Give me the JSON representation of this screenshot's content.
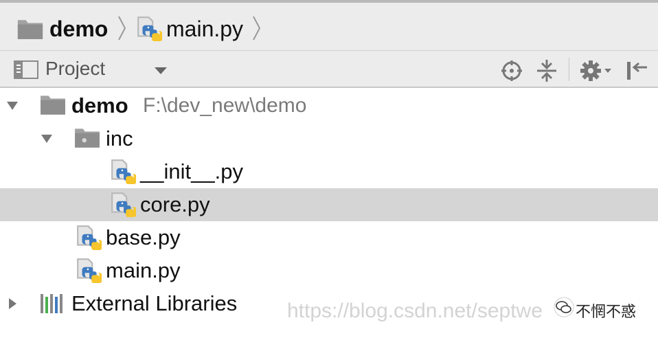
{
  "breadcrumb": {
    "project": "demo",
    "file": "main.py"
  },
  "tool_window": {
    "view_selector": "Project",
    "buttons": {
      "locate": "crosshair-icon",
      "collapse_all": "collapse-all-icon",
      "settings": "gear-icon",
      "hide": "hide-panel-icon"
    }
  },
  "tree": {
    "root": {
      "name": "demo",
      "path": "F:\\dev_new\\demo",
      "expanded": true
    },
    "inc": {
      "name": "inc",
      "expanded": true
    },
    "init_py": {
      "name": "__init__.py"
    },
    "core_py": {
      "name": "core.py",
      "selected": true
    },
    "base_py": {
      "name": "base.py"
    },
    "main_py": {
      "name": "main.py"
    },
    "external": {
      "name": "External Libraries",
      "expanded": false
    }
  },
  "watermark": {
    "url": "https://blog.csdn.net/septwe",
    "account": "不惘不惑"
  },
  "colors": {
    "python_blue": "#3f7bbf",
    "python_yellow": "#f7c52c",
    "folder_gray": "#9a9a9a",
    "selection": "#d5d5d5"
  }
}
